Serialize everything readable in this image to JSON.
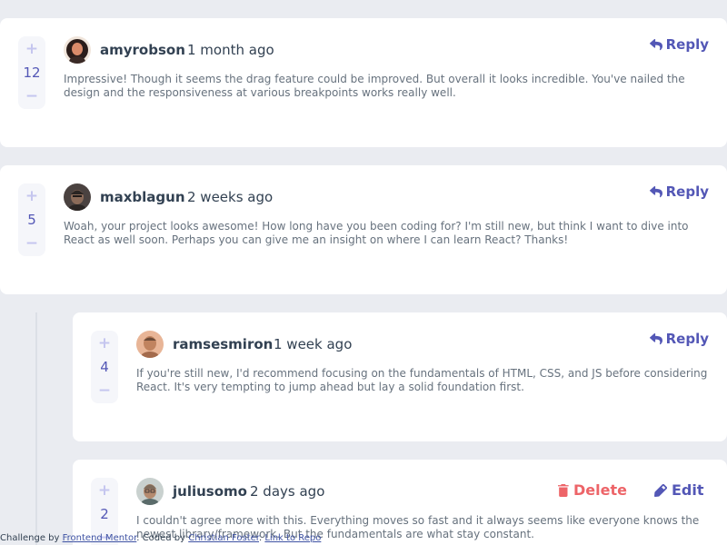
{
  "comments": [
    {
      "score": "12",
      "username": "amyrobson",
      "created_at": "1 month ago",
      "content": "Impressive! Though it seems the drag feature could be improved. But overall it looks incredible. You've nailed the design and the responsiveness at various breakpoints works really well.",
      "reply_label": "Reply",
      "avatar_colors": [
        "#d98b6a",
        "#2b1d1a"
      ]
    },
    {
      "score": "5",
      "username": "maxblagun",
      "created_at": "2 weeks ago",
      "content": "Woah, your project looks awesome! How long have you been coding for? I'm still new, but think I want to dive into React as well soon. Perhaps you can give me an insight on where I can learn React? Thanks!",
      "reply_label": "Reply",
      "avatar_colors": [
        "#8b6b59",
        "#2a2523"
      ]
    }
  ],
  "replies": [
    {
      "score": "4",
      "username": "ramsesmiron",
      "created_at": "1 week ago",
      "content": "If you're still new, I'd recommend focusing on the fundamentals of HTML, CSS, and JS before considering React. It's very tempting to jump ahead but lay a solid foundation first.",
      "reply_label": "Reply",
      "avatar_colors": [
        "#c0835f",
        "#e8b597"
      ]
    },
    {
      "score": "2",
      "username": "juliusomo",
      "created_at": "2 days ago",
      "content": "I couldn't agree more with this. Everything moves so fast and it always seems like everyone knows the newest library/framework. But the fundamentals are what stay constant.",
      "delete_label": "Delete",
      "edit_label": "Edit",
      "avatar_colors": [
        "#7e6c5c",
        "#c9d1cf"
      ]
    }
  ],
  "vote": {
    "plus": "+",
    "minus": "−"
  },
  "footer": {
    "prefix": "Challenge by ",
    "link1": "Frontend Mentor",
    "middle": ". Coded by ",
    "link2": "Christian Foster",
    "sep": ". ",
    "link3": "Link to Repo"
  },
  "colors": {
    "moderate_blue": "#5357b6",
    "soft_red": "#ed6468",
    "light_grayish_blue": "#c5c6ef",
    "dark_blue": "#324152",
    "grayish_blue": "#67727e",
    "background": "#eaecf1"
  }
}
